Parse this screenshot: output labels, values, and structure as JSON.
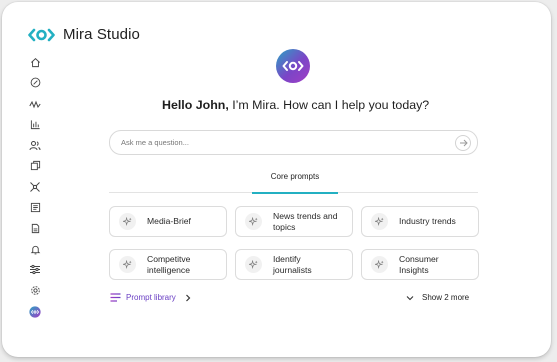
{
  "app": {
    "name": "Mira Studio",
    "accent_color": "#23b0c2",
    "brand_gradient": [
      "#2aa3c4",
      "#a13ec4"
    ]
  },
  "sidebar": {
    "items": [
      {
        "icon": "home-icon"
      },
      {
        "icon": "compass-icon"
      },
      {
        "icon": "waveform-icon"
      },
      {
        "icon": "bar-chart-icon"
      },
      {
        "icon": "users-icon"
      },
      {
        "icon": "copy-icon"
      },
      {
        "icon": "network-icon"
      },
      {
        "icon": "newspaper-icon"
      },
      {
        "icon": "document-icon"
      },
      {
        "icon": "bell-icon"
      },
      {
        "icon": "sliders-icon"
      },
      {
        "icon": "settings-icon"
      },
      {
        "icon": "mira-icon",
        "active": true
      }
    ]
  },
  "greeting": {
    "name": "Hello John,",
    "message": " I’m Mira. How can I help you today?"
  },
  "ask": {
    "placeholder": "Ask me a question..."
  },
  "tabs": [
    {
      "label": "Core prompts",
      "active": true
    }
  ],
  "prompts": [
    {
      "label": "Media-Brief"
    },
    {
      "label": "News trends and topics"
    },
    {
      "label": "Industry trends"
    },
    {
      "label": "Competitve intelligence"
    },
    {
      "label": "Identify journalists"
    },
    {
      "label": "Consumer Insights"
    }
  ],
  "footer": {
    "library_label": "Prompt library",
    "show_more_label": "Show 2 more"
  }
}
